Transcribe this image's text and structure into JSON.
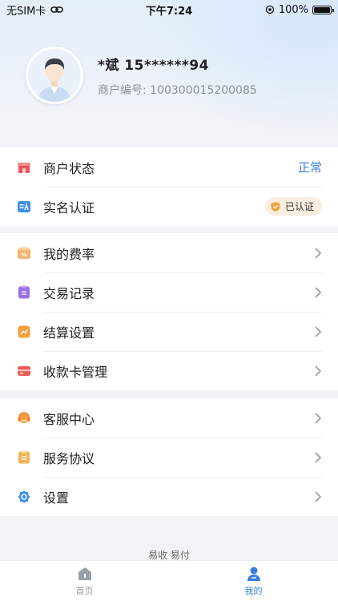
{
  "status_bar": {
    "carrier": "无SIM卡",
    "time": "下午7:24",
    "battery": "100%"
  },
  "profile": {
    "name": "*斌  15******94",
    "merchant_no": "商户编号: 100300015200085"
  },
  "section1": [
    {
      "label": "商户状态",
      "value": "正常",
      "icon": "shop-icon"
    },
    {
      "label": "实名认证",
      "badge": "已认证",
      "icon": "id-card-icon"
    }
  ],
  "section2": [
    {
      "label": "我的费率",
      "icon": "rate-icon"
    },
    {
      "label": "交易记录",
      "icon": "record-icon"
    },
    {
      "label": "结算设置",
      "icon": "settlement-icon"
    },
    {
      "label": "收款卡管理",
      "icon": "card-icon"
    }
  ],
  "section3": [
    {
      "label": "客服中心",
      "icon": "headset-icon"
    },
    {
      "label": "服务协议",
      "icon": "agreement-icon"
    },
    {
      "label": "设置",
      "icon": "gear-icon"
    }
  ],
  "footer": "易收 易付",
  "tabs": [
    {
      "label": "首页",
      "icon": "home-icon"
    },
    {
      "label": "我的",
      "icon": "user-icon"
    }
  ],
  "colors": {
    "accent": "#3b7ddd",
    "badge_bg": "#fbeee0"
  }
}
